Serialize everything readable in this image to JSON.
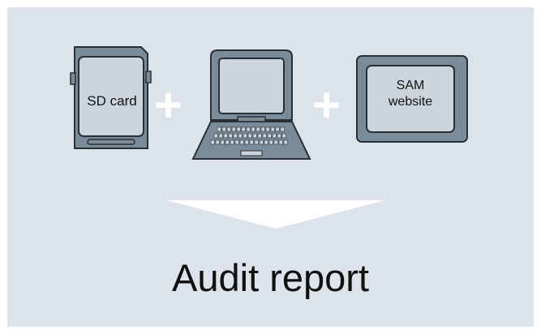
{
  "items": {
    "sd_card": {
      "label": "SD card"
    },
    "computer": {
      "label": ""
    },
    "sam_website": {
      "line1": "SAM",
      "line2": "website"
    }
  },
  "operators": [
    "+",
    "+"
  ],
  "result": {
    "label": "Audit report"
  },
  "colors": {
    "background": "#dde3ea",
    "device_body": "#7a8b9a",
    "device_screen": "#ccd4dc",
    "outline": "#2a2f35",
    "plus": "#ffffff",
    "arrow": "#ffffff"
  }
}
